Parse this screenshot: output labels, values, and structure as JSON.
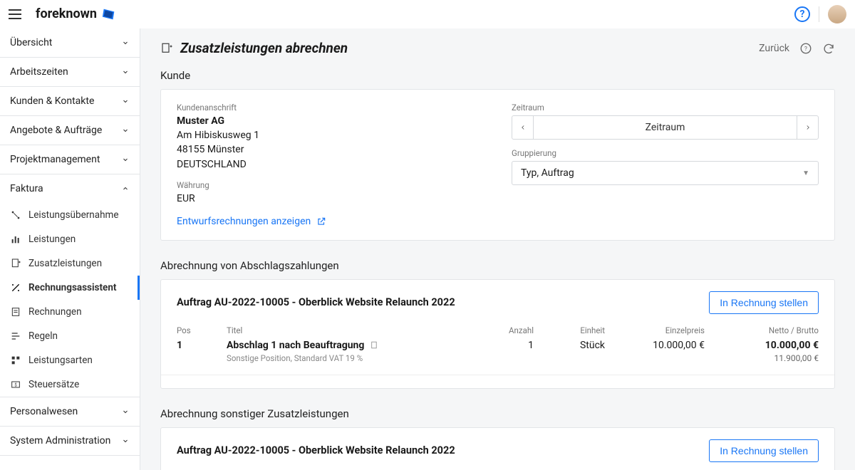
{
  "brand": "foreknown",
  "topbar": {
    "help_tooltip": "?"
  },
  "sidebar": {
    "groups": [
      {
        "label": "Übersicht",
        "expanded": false
      },
      {
        "label": "Arbeitszeiten",
        "expanded": false
      },
      {
        "label": "Kunden & Kontakte",
        "expanded": false
      },
      {
        "label": "Angebote & Aufträge",
        "expanded": false
      },
      {
        "label": "Projektmanagement",
        "expanded": false
      },
      {
        "label": "Faktura",
        "expanded": true,
        "items": [
          {
            "label": "Leistungsübernahme",
            "icon": "transfer"
          },
          {
            "label": "Leistungen",
            "icon": "bar"
          },
          {
            "label": "Zusatzleistungen",
            "icon": "add-doc"
          },
          {
            "label": "Rechnungsassistent",
            "icon": "wand",
            "active": true
          },
          {
            "label": "Rechnungen",
            "icon": "invoice"
          },
          {
            "label": "Regeln",
            "icon": "rules"
          },
          {
            "label": "Leistungsarten",
            "icon": "types"
          },
          {
            "label": "Steuersätze",
            "icon": "tax"
          }
        ]
      },
      {
        "label": "Personalwesen",
        "expanded": false
      },
      {
        "label": "System Administration",
        "expanded": false
      }
    ]
  },
  "page": {
    "title": "Zusatzleistungen abrechnen",
    "back": "Zurück"
  },
  "kunde": {
    "heading": "Kunde",
    "address_label": "Kundenanschrift",
    "name": "Muster AG",
    "street": "Am Hibiskusweg 1",
    "city": "48155 Münster",
    "country": "DEUTSCHLAND",
    "currency_label": "Währung",
    "currency": "EUR",
    "draft_link": "Entwurfsrechnungen anzeigen",
    "period_label": "Zeitraum",
    "period_value": "Zeitraum",
    "grouping_label": "Gruppierung",
    "grouping_value": "Typ, Auftrag"
  },
  "section1": {
    "heading": "Abrechnung von Abschlagszahlungen",
    "order_title": "Auftrag AU-2022-10005 - Oberblick Website Relaunch 2022",
    "invoice_btn": "In Rechnung stellen",
    "columns": {
      "pos": "Pos",
      "title": "Titel",
      "qty": "Anzahl",
      "unit": "Einheit",
      "price": "Einzelpreis",
      "total": "Netto / Brutto"
    },
    "row": {
      "pos": "1",
      "title": "Abschlag 1 nach Beauftragung",
      "sub": "Sonstige Position, Standard VAT 19 %",
      "qty": "1",
      "unit": "Stück",
      "price": "10.000,00 €",
      "netto": "10.000,00 €",
      "brutto": "11.900,00 €"
    }
  },
  "section2": {
    "heading": "Abrechnung sonstiger Zusatzleistungen",
    "order_title": "Auftrag AU-2022-10005 - Oberblick Website Relaunch 2022",
    "invoice_btn": "In Rechnung stellen"
  }
}
